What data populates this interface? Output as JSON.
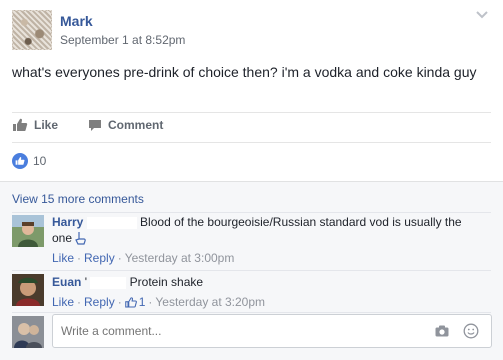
{
  "post": {
    "author": "Mark",
    "timestamp": "September 1 at 8:52pm",
    "text": "what's everyones pre-drink of choice then? i'm a vodka and coke kinda guy"
  },
  "actions": {
    "like_label": "Like",
    "comment_label": "Comment"
  },
  "reactions": {
    "count": "10"
  },
  "comments_section": {
    "view_more": "View 15 more comments",
    "comments": [
      {
        "name": "Harry",
        "text": "Blood of the bourgeoisie/Russian standard vod is usually the one",
        "like": "Like",
        "reply": "Reply",
        "time": "Yesterday at 3:00pm"
      },
      {
        "name": "Euan",
        "name_suffix": "'",
        "text": "Protein shake",
        "like": "Like",
        "reply": "Reply",
        "like_count": "1",
        "time": "Yesterday at 3:20pm"
      }
    ],
    "write_placeholder": "Write a comment..."
  },
  "colors": {
    "link_blue": "#365899",
    "reaction_blue": "#4a7ede",
    "meta_gray": "#90949c"
  }
}
